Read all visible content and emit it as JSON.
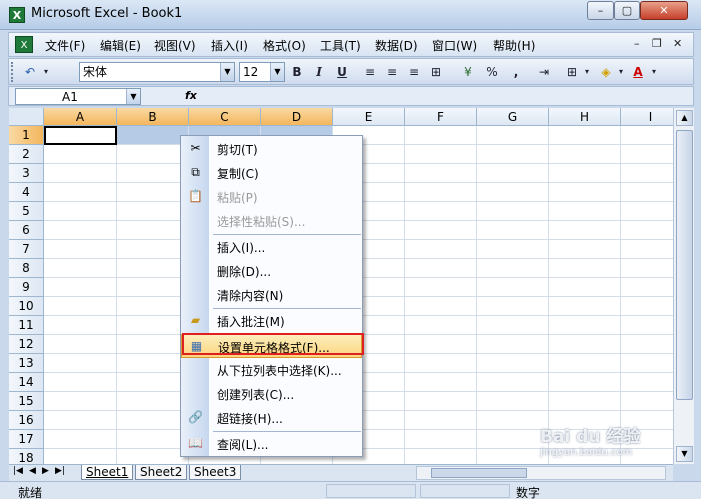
{
  "window": {
    "title": "Microsoft Excel - Book1",
    "min": "–",
    "max": "▢",
    "close": "✕"
  },
  "menubar": {
    "items": [
      "文件(F)",
      "编辑(E)",
      "视图(V)",
      "插入(I)",
      "格式(O)",
      "工具(T)",
      "数据(D)",
      "窗口(W)",
      "帮助(H)"
    ],
    "doc_min": "–",
    "doc_restore": "❐",
    "doc_close": "✕"
  },
  "toolbar": {
    "font": "宋体",
    "size": "12",
    "bold": "B",
    "italic": "I",
    "underline": "U",
    "percent": "%",
    "comma": ","
  },
  "formula": {
    "namebox": "A1",
    "fx": "fx"
  },
  "grid": {
    "columns": [
      "A",
      "B",
      "C",
      "D",
      "E",
      "F",
      "G",
      "H",
      "I"
    ],
    "rows": [
      "1",
      "2",
      "3",
      "4",
      "5",
      "6",
      "7",
      "8",
      "9",
      "10",
      "11",
      "12",
      "13",
      "14",
      "15",
      "16",
      "17",
      "18"
    ]
  },
  "context_menu": {
    "items": [
      {
        "label": "剪切(T)",
        "icon": "scissors-icon",
        "disabled": false
      },
      {
        "label": "复制(C)",
        "icon": "copy-icon",
        "disabled": false
      },
      {
        "label": "粘贴(P)",
        "icon": "paste-icon",
        "disabled": true
      },
      {
        "label": "选择性粘贴(S)...",
        "icon": "",
        "disabled": true
      },
      {
        "label": "插入(I)...",
        "icon": "",
        "disabled": false
      },
      {
        "label": "删除(D)...",
        "icon": "",
        "disabled": false
      },
      {
        "label": "清除内容(N)",
        "icon": "",
        "disabled": false
      },
      {
        "label": "插入批注(M)",
        "icon": "comment-icon",
        "disabled": false
      },
      {
        "label": "设置单元格格式(F)...",
        "icon": "format-cells-icon",
        "disabled": false
      },
      {
        "label": "从下拉列表中选择(K)...",
        "icon": "",
        "disabled": false
      },
      {
        "label": "创建列表(C)...",
        "icon": "",
        "disabled": false
      },
      {
        "label": "超链接(H)...",
        "icon": "hyperlink-icon",
        "disabled": false
      },
      {
        "label": "查阅(L)...",
        "icon": "research-icon",
        "disabled": false
      }
    ]
  },
  "sheets": [
    "Sheet1",
    "Sheet2",
    "Sheet3"
  ],
  "status": {
    "left": "就绪",
    "mode": "数字"
  },
  "watermark": {
    "line1": "Bai du 经验",
    "line2": "jingyan.baidu.com"
  },
  "colors": {
    "highlight_border": "#e02020",
    "selected_header": "#f3b65c",
    "selection": "#b6cbe6"
  }
}
